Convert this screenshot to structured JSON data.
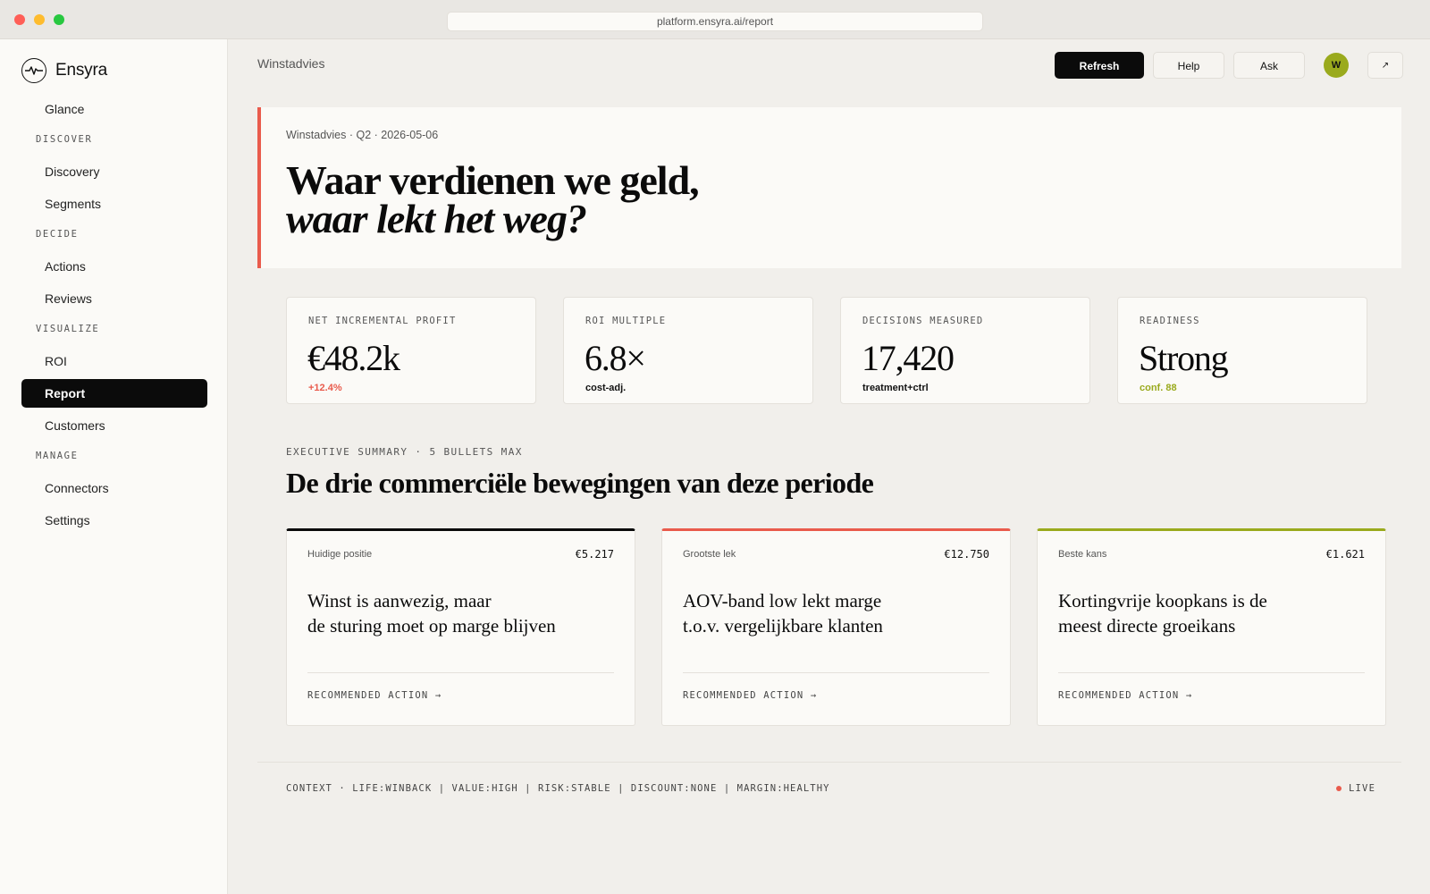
{
  "browser": {
    "url": "platform.ensyra.ai/report"
  },
  "brand": {
    "name": "Ensyra",
    "icon": "pulse-icon"
  },
  "nav": {
    "glance": "Glance",
    "sections": [
      {
        "title": "DISCOVER",
        "items": [
          "Discovery",
          "Segments"
        ]
      },
      {
        "title": "DECIDE",
        "items": [
          "Actions",
          "Reviews"
        ]
      },
      {
        "title": "VISUALIZE",
        "items": [
          "ROI",
          "Report",
          "Customers"
        ]
      },
      {
        "title": "MANAGE",
        "items": [
          "Connectors",
          "Settings"
        ]
      }
    ],
    "active": "Report"
  },
  "header": {
    "breadcrumb": "Winstadvies",
    "refresh": "Refresh",
    "help": "Help",
    "ask": "Ask",
    "avatar": "W",
    "external_icon": "↗"
  },
  "hero": {
    "meta": "Winstadvies · Q2 · 2026-05-06",
    "title_line1": "Waar verdienen we geld,",
    "title_line2": "waar lekt het weg?"
  },
  "kpis": [
    {
      "label": "NET INCREMENTAL PROFIT",
      "value": "€48.2k",
      "sub": "+12.4%",
      "sub_color": "#e95b4c"
    },
    {
      "label": "ROI MULTIPLE",
      "value": "6.8×",
      "sub": "cost-adj.",
      "sub_color": "#111111"
    },
    {
      "label": "DECISIONS MEASURED",
      "value": "17,420",
      "sub": "treatment+ctrl",
      "sub_color": "#111111"
    },
    {
      "label": "READINESS",
      "value": "Strong",
      "sub": "conf. 88",
      "sub_color": "#9aaa1d"
    }
  ],
  "summary": {
    "label": "EXECUTIVE SUMMARY · 5 BULLETS MAX",
    "title": "De drie commerciële bewegingen van deze periode",
    "cards": [
      {
        "tag": "Huidige positie",
        "amount": "€5.217",
        "line1": "Winst is aanwezig, maar",
        "line2": "de sturing moet op marge blijven",
        "action": "RECOMMENDED ACTION →",
        "accent": "#0b0b0b"
      },
      {
        "tag": "Grootste lek",
        "amount": "€12.750",
        "line1": "AOV-band low lekt marge",
        "line2": "t.o.v. vergelijkbare klanten",
        "action": "RECOMMENDED ACTION →",
        "accent": "#e95b4c"
      },
      {
        "tag": "Beste kans",
        "amount": "€1.621",
        "line1": "Kortingvrije koopkans is de",
        "line2": "meest directe groeikans",
        "action": "RECOMMENDED ACTION →",
        "accent": "#9aaa1d"
      }
    ]
  },
  "footer": {
    "context": "CONTEXT · LIFE:WINBACK | VALUE:HIGH | RISK:STABLE | DISCOUNT:NONE | MARGIN:HEALTHY",
    "live": "LIVE"
  }
}
